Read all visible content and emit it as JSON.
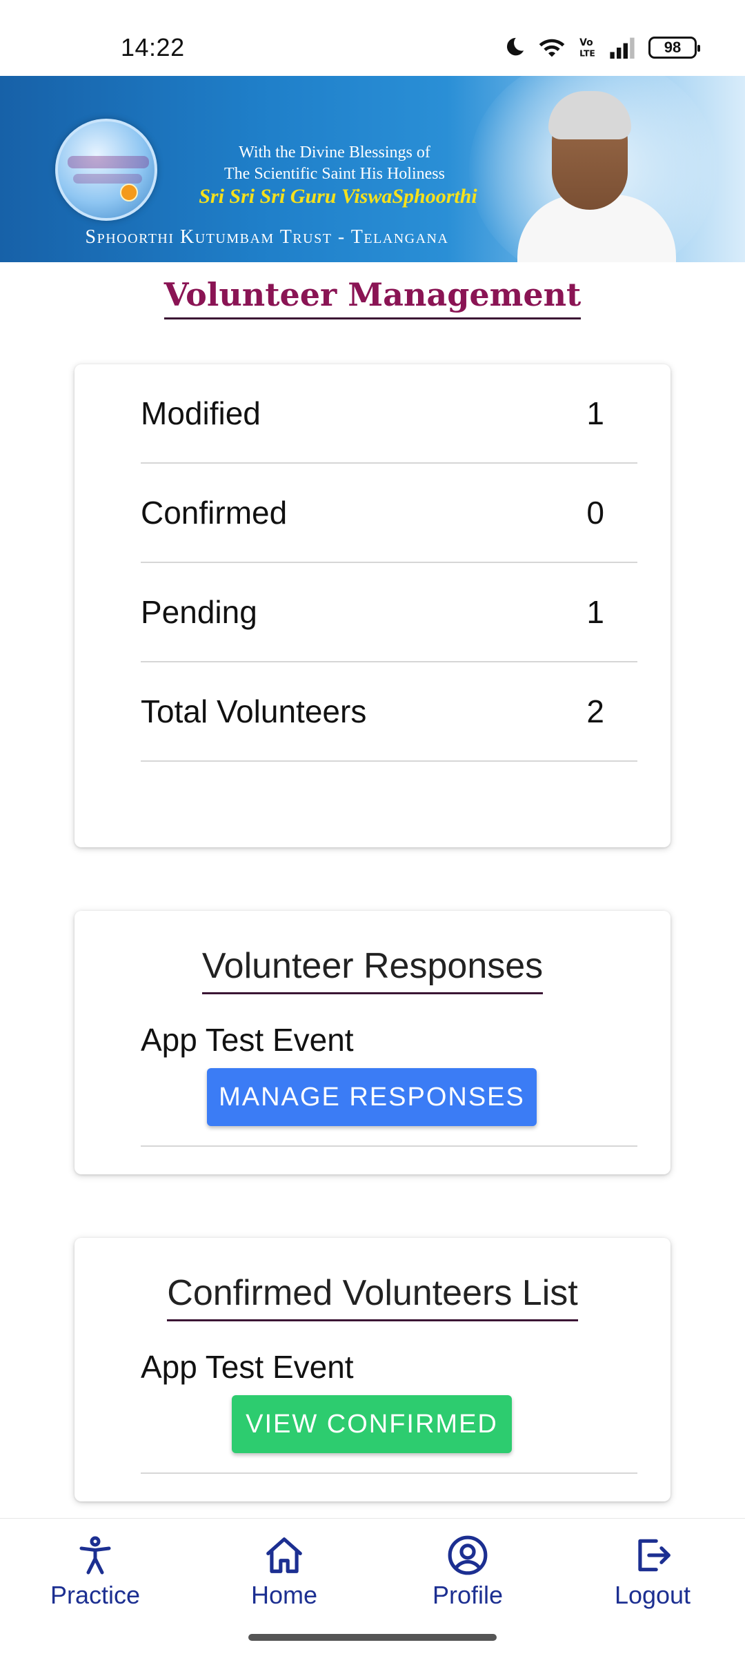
{
  "status_bar": {
    "time": "14:22",
    "battery": "98"
  },
  "banner": {
    "line1": "With the Divine Blessings of",
    "line2": "The Scientific Saint His Holiness",
    "name": "Sri Sri Sri Guru ViswaSphoorthi",
    "trust": "Sphoorthi Kutumbam Trust - Telangana"
  },
  "page": {
    "title": "Volunteer Management"
  },
  "stats": [
    {
      "label": "Modified",
      "value": "1"
    },
    {
      "label": "Confirmed",
      "value": "0"
    },
    {
      "label": "Pending",
      "value": "1"
    },
    {
      "label": "Total Volunteers",
      "value": "2"
    }
  ],
  "responses_card": {
    "title": "Volunteer Responses",
    "event": "App Test Event",
    "button": "MANAGE RESPONSES"
  },
  "confirmed_card": {
    "title": "Confirmed Volunteers List",
    "event": "App Test Event",
    "button": "VIEW CONFIRMED"
  },
  "nav": [
    {
      "label": "Practice",
      "icon": "person-icon"
    },
    {
      "label": "Home",
      "icon": "home-icon"
    },
    {
      "label": "Profile",
      "icon": "profile-icon"
    },
    {
      "label": "Logout",
      "icon": "logout-icon"
    }
  ],
  "colors": {
    "title": "#8a1454",
    "nav": "#1c2f91",
    "manage_button": "#3b7cf5",
    "confirm_button": "#2dcc6f"
  }
}
